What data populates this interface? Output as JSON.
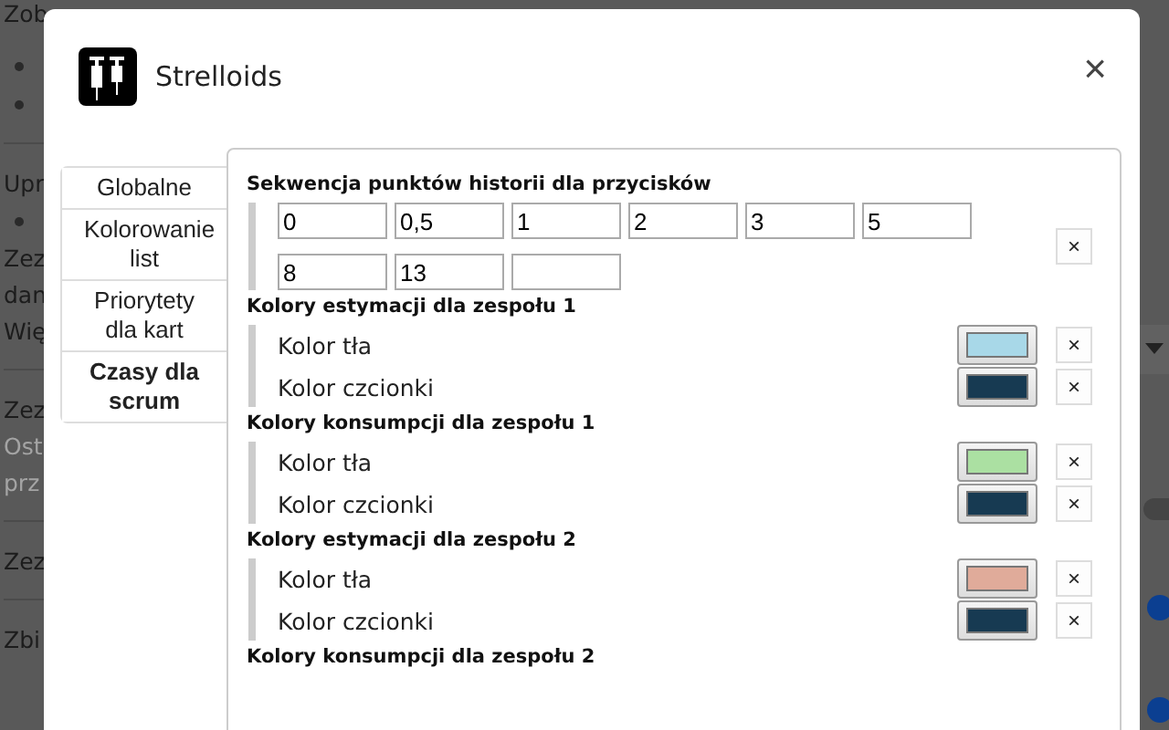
{
  "page_items": [
    {
      "kind": "text",
      "text": "Zob",
      "muted": false
    },
    {
      "kind": "bullet"
    },
    {
      "kind": "bullet"
    },
    {
      "kind": "divider"
    },
    {
      "kind": "text",
      "text": "Upr",
      "muted": false
    },
    {
      "kind": "bullet"
    },
    {
      "kind": "text",
      "text": "Zez",
      "muted": false
    },
    {
      "kind": "text",
      "text": "dan",
      "muted": false
    },
    {
      "kind": "text",
      "text": "Wię",
      "muted": false
    },
    {
      "kind": "divider"
    },
    {
      "kind": "text",
      "text": "Zez",
      "muted": false
    },
    {
      "kind": "text",
      "text": "Ost",
      "muted": true
    },
    {
      "kind": "text",
      "text": "prz",
      "muted": true
    },
    {
      "kind": "divider"
    },
    {
      "kind": "text",
      "text": "Zez",
      "muted": false
    },
    {
      "kind": "divider"
    },
    {
      "kind": "text",
      "text": "Zbi",
      "muted": false
    }
  ],
  "page_side": [
    {
      "kind": "dropdown"
    },
    {
      "kind": "toggle",
      "on": false
    },
    {
      "kind": "slider"
    },
    {
      "kind": "slider"
    }
  ],
  "dialog": {
    "title": "Strelloids",
    "close": "×",
    "tabs": [
      {
        "label": "Globalne",
        "selected": false
      },
      {
        "label": "Kolorowanie list",
        "selected": false
      },
      {
        "label": "Priorytety dla kart",
        "selected": false
      },
      {
        "label": "Czasy dla scrum",
        "selected": true
      }
    ],
    "sequence": {
      "heading": "Sekwencja punktów historii dla przycisków",
      "values": [
        "0",
        "0,5",
        "1",
        "2",
        "3",
        "5",
        "8",
        "13"
      ],
      "remove": "×"
    },
    "color_groups": [
      {
        "heading": "Kolory estymacji dla zespołu 1",
        "rows": [
          {
            "label": "Kolor tła",
            "color": "#a8d8e8",
            "remove": "×"
          },
          {
            "label": "Kolor czcionki",
            "color": "#173a52",
            "remove": "×"
          }
        ]
      },
      {
        "heading": "Kolory konsumpcji dla zespołu 1",
        "rows": [
          {
            "label": "Kolor tła",
            "color": "#abe0a2",
            "remove": "×"
          },
          {
            "label": "Kolor czcionki",
            "color": "#173a52",
            "remove": "×"
          }
        ]
      },
      {
        "heading": "Kolory estymacji dla zespołu 2",
        "rows": [
          {
            "label": "Kolor tła",
            "color": "#e0ab9a",
            "remove": "×"
          },
          {
            "label": "Kolor czcionki",
            "color": "#173a52",
            "remove": "×"
          }
        ]
      },
      {
        "heading": "Kolory konsumpcji dla zespołu 2"
      }
    ]
  }
}
